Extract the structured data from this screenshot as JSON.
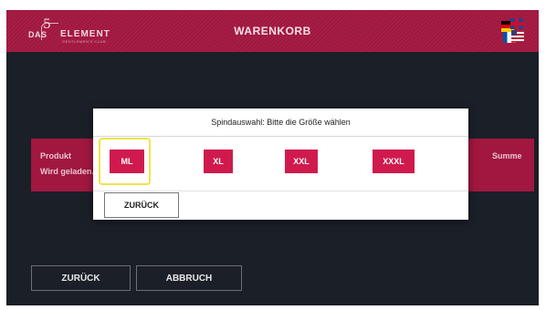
{
  "header": {
    "logo": {
      "das": "DAS",
      "number": "5",
      "element": "ELEMENT",
      "tagline": "GENTLEMEN'S CLUB"
    },
    "title": "WARENKORB",
    "language_icon": "language-flags-icon"
  },
  "product_band": {
    "col_product": "Produkt",
    "loading": "Wird geladen.",
    "col_sum": "Summe"
  },
  "footer": {
    "back_label": "ZURÜCK",
    "cancel_label": "ABBRUCH"
  },
  "modal": {
    "title": "Spindauswahl: Bitte die Größe wählen",
    "sizes": [
      "ML",
      "XL",
      "XXL",
      "XXXL"
    ],
    "selected": "ML",
    "back_label": "ZURÜCK"
  },
  "colors": {
    "brand": "#a1173f",
    "size_button": "#d01a4d",
    "highlight": "#f2e34b",
    "background": "#1b1f27"
  }
}
